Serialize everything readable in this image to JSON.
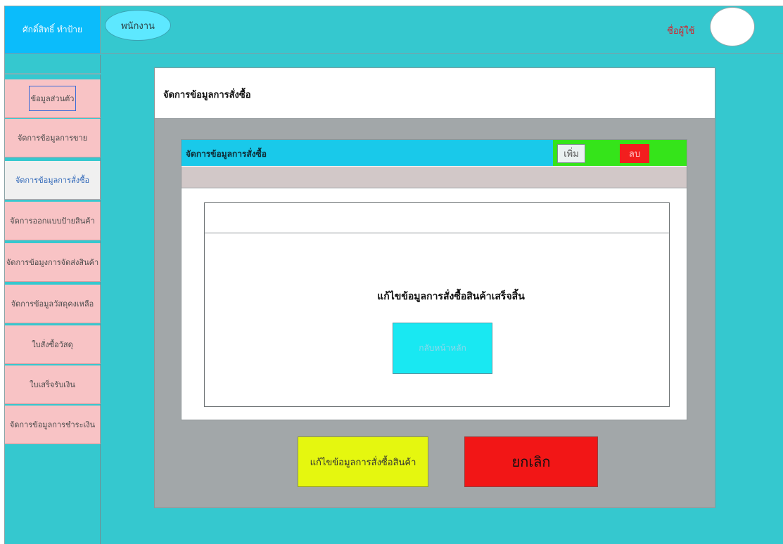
{
  "brand": {
    "name": "ศักดิ์สิทธิ์ ทำป้าย"
  },
  "topbar": {
    "role": "พนักงาน",
    "user_label": "ชื่อผู้ใช้"
  },
  "sidebar": {
    "items": [
      {
        "label": "ข้อมูลส่วนตัว"
      },
      {
        "label": "จัดการข้อมูลการขาย"
      },
      {
        "label": "จัดการข้อมูลการสั่งซื้อ"
      },
      {
        "label": "จัดการออกแบบป้ายสินค้า"
      },
      {
        "label": "จัดการข้อมูงการจัดส่งสินค้า"
      },
      {
        "label": "จัดการข้อมูลวัสดุคงเหลือ"
      },
      {
        "label": "ใบสั่งซื้อวัสดุ"
      },
      {
        "label": "ใบเสร็จรับเงิน"
      },
      {
        "label": "จัดการข้อมูลการชำระเงิน"
      }
    ],
    "active_index": 2
  },
  "panel": {
    "title": "จัดการข้อมูลการสั่งซื้อ",
    "inner_title": "จัดการข้อมูลการสั่งซื้อ",
    "add_label": "เพิ่ม",
    "delete_label": "ลบ"
  },
  "dialog": {
    "message": "แก้ไขข้อมูลการสั่งซื้อสินค้าเสร็จสิ้น",
    "home_label": "กลับหน้าหลัก"
  },
  "actions": {
    "save_label": "แก้ไขข้อมูลการสั่งซื้อสินค้า",
    "cancel_label": "ยกเลิก"
  },
  "colors": {
    "background": "#35c8cf",
    "brand": "#0bbcfb",
    "nav_item": "#f8c3c5",
    "panel": "#a2a7a9",
    "bar": "#19c9ea",
    "action_zone": "#35e41a",
    "delete": "#f21e1e",
    "save": "#e5f70f",
    "cancel": "#f21616"
  }
}
